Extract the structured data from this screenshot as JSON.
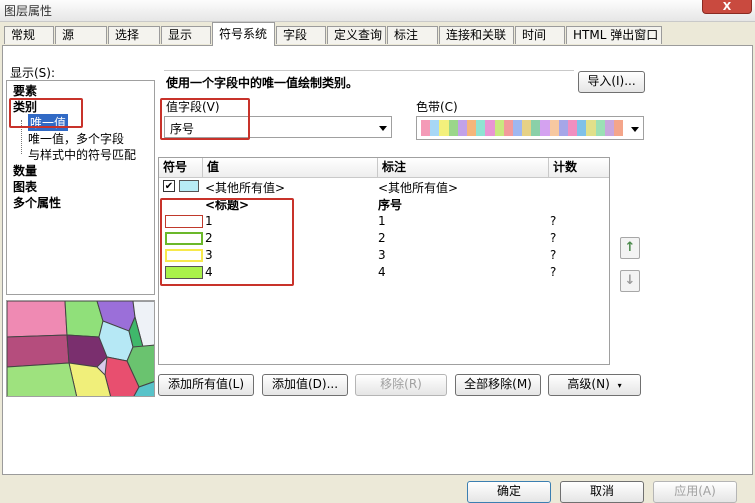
{
  "window": {
    "title": "图层属性",
    "close_glyph": "X"
  },
  "tabs": [
    {
      "label": "常规"
    },
    {
      "label": "源"
    },
    {
      "label": "选择"
    },
    {
      "label": "显示"
    },
    {
      "label": "符号系统"
    },
    {
      "label": "字段"
    },
    {
      "label": "定义查询"
    },
    {
      "label": "标注"
    },
    {
      "label": "连接和关联"
    },
    {
      "label": "时间"
    },
    {
      "label": "HTML 弹出窗口"
    }
  ],
  "show": {
    "label": "显示(S):",
    "tree": [
      {
        "label": "要素"
      },
      {
        "label": "类别"
      },
      {
        "label": "唯一值"
      },
      {
        "label": "唯一值，多个字段"
      },
      {
        "label": "与样式中的符号匹配"
      },
      {
        "label": "数量"
      },
      {
        "label": "图表"
      },
      {
        "label": "多个属性"
      }
    ]
  },
  "description": "使用一个字段中的唯一值绘制类别。",
  "import_button": "导入(I)...",
  "value_field": {
    "label": "值字段(V)",
    "value": "序号"
  },
  "color_ramp": {
    "label": "色带(C)",
    "colors": [
      "#f49ab7",
      "#a7d7f5",
      "#f3f07c",
      "#9bd68a",
      "#c2a2e8",
      "#f5b67a",
      "#8fe3d2",
      "#e895d3",
      "#c9e87f",
      "#f29b9b",
      "#9fb7f0",
      "#e6d185",
      "#8ad0a8",
      "#d4a2f0",
      "#f7c8a0",
      "#a6a6e8",
      "#f08fc0",
      "#7fc1e8",
      "#e0e08a",
      "#9be0b5",
      "#c8a6dd",
      "#f4a58a"
    ]
  },
  "table": {
    "headers": {
      "symbol": "符号",
      "value": "值",
      "label": "标注",
      "count": "计数"
    },
    "rows": [
      {
        "value": "<其他所有值>",
        "label": "<其他所有值>",
        "count": "",
        "swatch": "#b8ecf5",
        "checkbox": true
      },
      {
        "value": "<标题>",
        "label": "序号",
        "count": "",
        "swatch": "",
        "heading": true
      },
      {
        "value": "1",
        "label": "1",
        "count": "?",
        "swatch": "#ffffff"
      },
      {
        "value": "2",
        "label": "2",
        "count": "?",
        "swatch": "#ffffff"
      },
      {
        "value": "3",
        "label": "3",
        "count": "?",
        "swatch": "#ffffff"
      },
      {
        "value": "4",
        "label": "4",
        "count": "?",
        "swatch": "#aaf24a"
      }
    ]
  },
  "buttons": {
    "add_all": "添加所有值(L)",
    "add": "添加值(D)...",
    "remove": "移除(R)",
    "remove_all": "全部移除(M)",
    "advanced": "高级(N)"
  },
  "footer": {
    "ok": "确定",
    "cancel": "取消",
    "apply": "应用(A)"
  }
}
